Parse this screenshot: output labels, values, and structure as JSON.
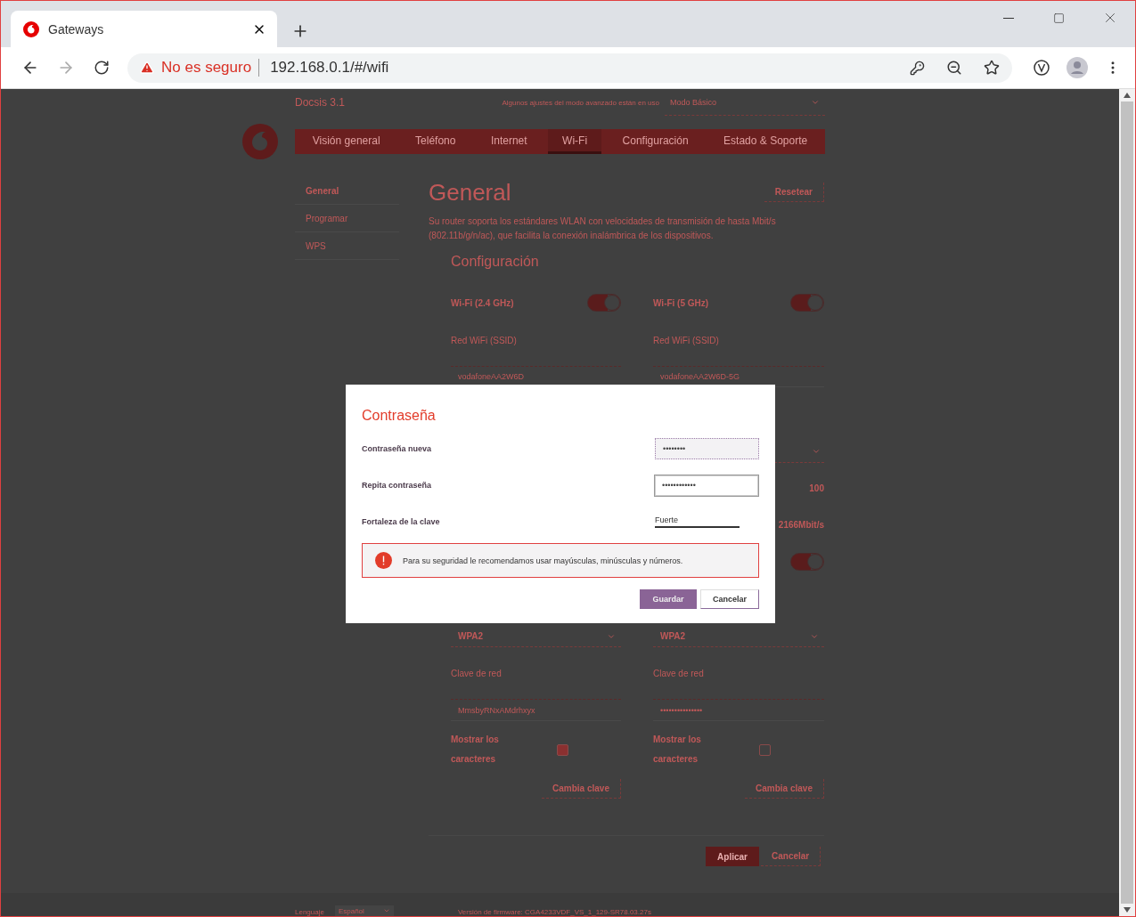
{
  "browser": {
    "tab_title": "Gateways",
    "warning": "No es seguro",
    "url": "192.168.0.1/#/wifi"
  },
  "header": {
    "product": "Docsis 3.1",
    "notice": "Algunos ajustes del modo avanzado están en uso",
    "mode": "Modo Básico"
  },
  "nav": [
    {
      "label": "Visión general",
      "selected": false
    },
    {
      "label": "Teléfono",
      "selected": false
    },
    {
      "label": "Internet",
      "selected": false
    },
    {
      "label": "Wi-Fi",
      "selected": true
    },
    {
      "label": "Configuración",
      "selected": false
    },
    {
      "label": "Estado & Soporte",
      "selected": false
    }
  ],
  "sidebar": [
    {
      "label": "General",
      "selected": true
    },
    {
      "label": "Programar",
      "selected": false
    },
    {
      "label": "WPS",
      "selected": false
    }
  ],
  "main": {
    "title": "General",
    "reset": "Resetear",
    "description": "Su router soporta los estándares WLAN con velocidades de transmisión de hasta Mbit/s (802.11b/g/n/ac), que facilita la conexión inalámbrica de los dispositivos.",
    "section": "Configuración"
  },
  "bands": [
    {
      "label": "Wi-Fi (2.4 GHz)",
      "enabled": true,
      "ssid_label": "Red WiFi (SSID)",
      "ssid": "vodafoneAA2W6D",
      "security": "WPA2",
      "key_label": "Clave de red",
      "key": "MmsbyRNxAMdrhxyx",
      "show_label": "Mostrar los caracteres",
      "show_checked": true,
      "change": "Cambia clave"
    },
    {
      "label": "Wi-Fi (5 GHz)",
      "enabled": true,
      "ssid_label": "Red WiFi (SSID)",
      "ssid": "vodafoneAA2W6D-5G",
      "hidden_rows": [
        {
          "kind": "select"
        },
        {
          "kind": "text",
          "text": "100"
        },
        {
          "kind": "text",
          "text": "2166Mbit/s"
        },
        {
          "kind": "toggle",
          "on": true
        }
      ],
      "security": "WPA2",
      "key_label": "Clave de red",
      "key": "•••••••••••••••",
      "show_label": "Mostrar los caracteres",
      "show_checked": false,
      "change": "Cambia clave"
    }
  ],
  "actions": [
    "Aplicar",
    "Cancelar"
  ],
  "footer": {
    "language_label": "Lenguaje",
    "language": "Español",
    "firmware": "Versión de firmware: CGA4233VDF_VS_1_129-SR78.03.27s"
  },
  "dialog": {
    "title": "Contraseña",
    "fields": [
      {
        "label": "Contraseña nueva",
        "value": "••••••••",
        "focused": false
      },
      {
        "label": "Repita contraseña",
        "value": "••••••••••••",
        "focused": true
      }
    ],
    "strength_label": "Fortaleza de la clave",
    "strength": "Fuerte",
    "warning": "Para su seguridad le recomendamos usar mayúsculas, minúsculas y números.",
    "buttons": [
      "Guardar",
      "Cancelar"
    ]
  }
}
